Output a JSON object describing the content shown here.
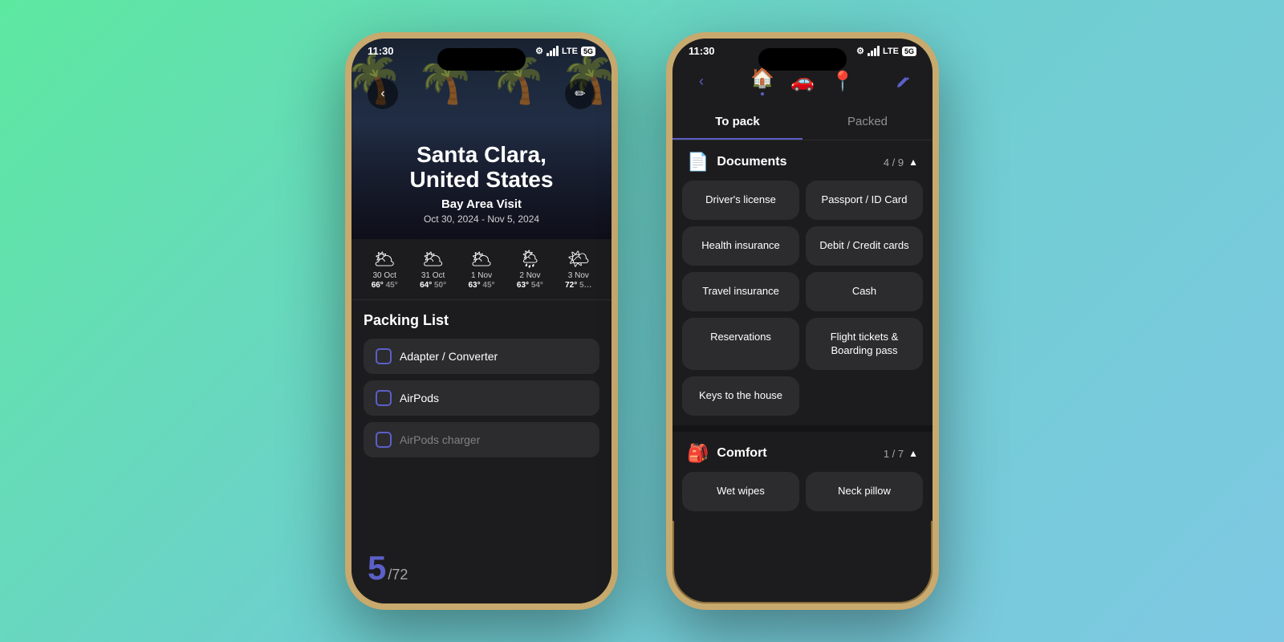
{
  "background": "linear-gradient(135deg, #5de8a0 0%, #6ecfcf 50%, #7ec8e3 100%)",
  "phone1": {
    "status": {
      "time": "11:30",
      "settings_icon": "⚙",
      "signal": "▪▪▪",
      "lte": "LTE",
      "network": "5G"
    },
    "hero": {
      "city": "Santa Clara,",
      "country": "United States",
      "trip_name": "Bay Area Visit",
      "dates": "Oct 30, 2024 - Nov 5, 2024"
    },
    "weather": [
      {
        "date": "30 Oct",
        "icon": "🌥",
        "high": "66°",
        "low": "45°"
      },
      {
        "date": "31 Oct",
        "icon": "🌥",
        "high": "64°",
        "low": "50°"
      },
      {
        "date": "1 Nov",
        "icon": "🌥",
        "high": "63°",
        "low": "45°"
      },
      {
        "date": "2 Nov",
        "icon": "🌦",
        "high": "63°",
        "low": "54°"
      },
      {
        "date": "3 Nov",
        "icon": "🌤",
        "high": "72°",
        "low": "5…"
      }
    ],
    "packing": {
      "title": "Packing List",
      "items": [
        {
          "label": "Adapter / Converter",
          "checked": false
        },
        {
          "label": "AirPods",
          "checked": false
        },
        {
          "label": "AirPods charger",
          "checked": false
        }
      ],
      "counter": "5",
      "total": "/72"
    }
  },
  "phone2": {
    "status": {
      "time": "11:30",
      "settings_icon": "⚙",
      "signal": "▪▪▪",
      "lte": "LTE",
      "network": "5G"
    },
    "nav": {
      "back_label": "‹",
      "icons": [
        {
          "emoji": "🏠",
          "active": true
        },
        {
          "emoji": "🚗",
          "active": false
        },
        {
          "emoji": "📍",
          "active": false
        }
      ],
      "edit_label": "✏"
    },
    "tabs": [
      {
        "label": "To pack",
        "active": true
      },
      {
        "label": "Packed",
        "active": false
      }
    ],
    "categories": [
      {
        "name": "Documents",
        "icon": "📄",
        "count": "4 / 9",
        "expanded": true,
        "items": [
          {
            "label": "Driver's license",
            "col": 0
          },
          {
            "label": "Passport / ID Card",
            "col": 1
          },
          {
            "label": "Health insurance",
            "col": 0
          },
          {
            "label": "Debit / Credit cards",
            "col": 1
          },
          {
            "label": "Travel insurance",
            "col": 0
          },
          {
            "label": "Cash",
            "col": 1
          },
          {
            "label": "Reservations",
            "col": 0
          },
          {
            "label": "Flight tickets & Boarding pass",
            "col": 1
          },
          {
            "label": "Keys to the house",
            "col": 0
          }
        ]
      },
      {
        "name": "Comfort",
        "icon": "🎒",
        "count": "1 / 7",
        "expanded": true,
        "items": [
          {
            "label": "Wet wipes",
            "col": 0
          },
          {
            "label": "Neck pillow",
            "col": 1
          }
        ]
      }
    ]
  }
}
